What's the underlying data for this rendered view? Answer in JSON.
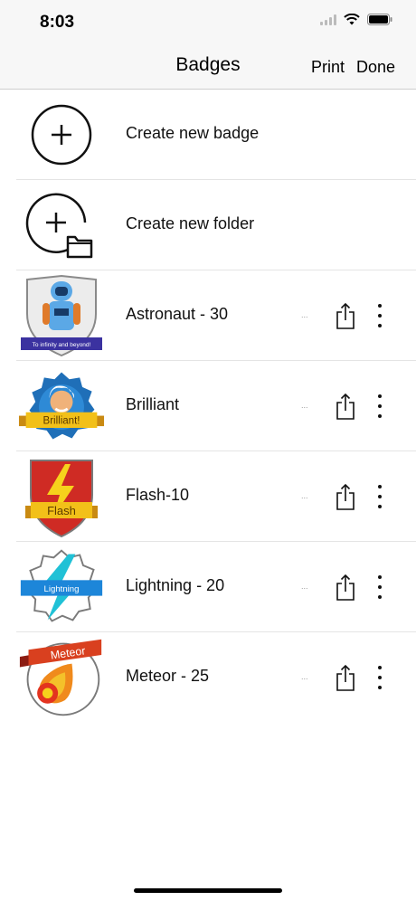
{
  "status_bar": {
    "time": "8:03",
    "icons": [
      "signal-icon",
      "wifi-icon",
      "battery-icon"
    ]
  },
  "nav": {
    "title": "Badges",
    "print_label": "Print",
    "done_label": "Done"
  },
  "actions": [
    {
      "label": "Create new badge",
      "icon": "plus-circle-icon"
    },
    {
      "label": "Create new folder",
      "icon": "folder-plus-icon"
    }
  ],
  "badges": [
    {
      "label": "Astronaut - 30",
      "ellipsis": "...",
      "ribbon": "To infinity and beyond!",
      "icon": "astronaut-badge-icon"
    },
    {
      "label": "Brilliant",
      "ellipsis": "...",
      "ribbon": "Brilliant!",
      "icon": "brilliant-badge-icon"
    },
    {
      "label": "Flash-10",
      "ellipsis": "...",
      "ribbon": "Flash",
      "icon": "flash-badge-icon"
    },
    {
      "label": "Lightning - 20",
      "ellipsis": "...",
      "ribbon": "Lightning",
      "icon": "lightning-badge-icon"
    },
    {
      "label": "Meteor - 25",
      "ellipsis": "...",
      "ribbon": "Meteor",
      "icon": "meteor-badge-icon"
    }
  ],
  "colors": {
    "nav_bg": "#f7f7f7",
    "separator": "#e4e4e4",
    "text": "#111111"
  }
}
